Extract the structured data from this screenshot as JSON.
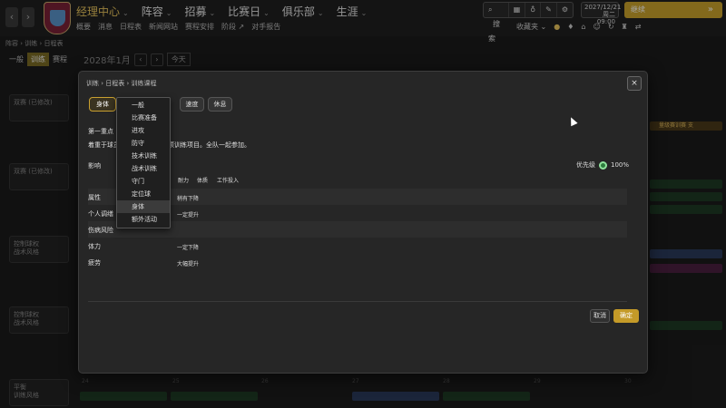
{
  "topbar": {
    "nav_back": "‹",
    "nav_forward": "›",
    "main_nav": [
      "经理中心",
      "阵容",
      "招募",
      "比赛日",
      "俱乐部",
      "生涯"
    ],
    "sub_nav": [
      "概要",
      "消息",
      "日程表",
      "新闻网站",
      "赛程安排",
      "阶段 ↗",
      "对手报告"
    ],
    "search_label": "搜索",
    "date": "2027/12/21",
    "day_time": "周二 09:00",
    "continue_label": "继续",
    "continue_icon": "»",
    "favorites_label": "收藏夹"
  },
  "background": {
    "breadcrumb": "阵容 › 训练 › 日程表",
    "tabs": [
      "一般",
      "训练",
      "赛程"
    ],
    "month": "2028年1月",
    "month_action": "今天",
    "rows": [
      {
        "title": "双赛 (已修改)",
        "sub": ""
      },
      {
        "title": "双赛 (已修改)",
        "sub": ""
      },
      {
        "title": "控制球权",
        "sub": "战术风格"
      },
      {
        "title": "控制球权",
        "sub": "战术风格"
      },
      {
        "title": "平衡",
        "sub": "训练风格"
      }
    ],
    "day_numbers": [
      "24",
      "25",
      "26",
      "27",
      "28",
      "29",
      "30"
    ],
    "right_chip": "量级赛训赛",
    "right_chip_action": "支"
  },
  "modal": {
    "breadcrumb": "训练 › 日程表 › 训练课程",
    "close_icon": "×",
    "tabs": [
      {
        "label": "身体",
        "selected": true
      },
      {
        "label": "速度",
        "selected": false
      },
      {
        "label": "休息",
        "selected": false
      }
    ],
    "primary_focus_label": "第一重点",
    "description_prefix": "着重于球员",
    "description_suffix": "项训练项目。全队一起参加。",
    "impact_label": "影响",
    "priority_label": "优先级",
    "priority_value": "100%",
    "col_stamina": "耐力",
    "col_physical": "体质",
    "col_workload": "工作投入",
    "effects": [
      {
        "name": "属性",
        "value": "稍有下降"
      },
      {
        "name": "个人调缮",
        "value": "一定提升"
      },
      {
        "name": "伤病风险",
        "value": ""
      },
      {
        "name": "体力",
        "value": "一定下降"
      },
      {
        "name": "疲劳",
        "value": "大幅提升"
      }
    ],
    "cancel_label": "取消",
    "ok_label": "确定"
  },
  "dropdown": {
    "items": [
      "一般",
      "比赛准备",
      "进攻",
      "防守",
      "技术训练",
      "战术训练",
      "守门",
      "定位球",
      "身体",
      "额外活动"
    ],
    "highlighted": "身体"
  },
  "colors": {
    "accent": "#caa22c",
    "background": "#1b1b1b",
    "modal": "#262626",
    "active_nav": "#e8c45c",
    "priority_dot": "#2e7d3e"
  }
}
